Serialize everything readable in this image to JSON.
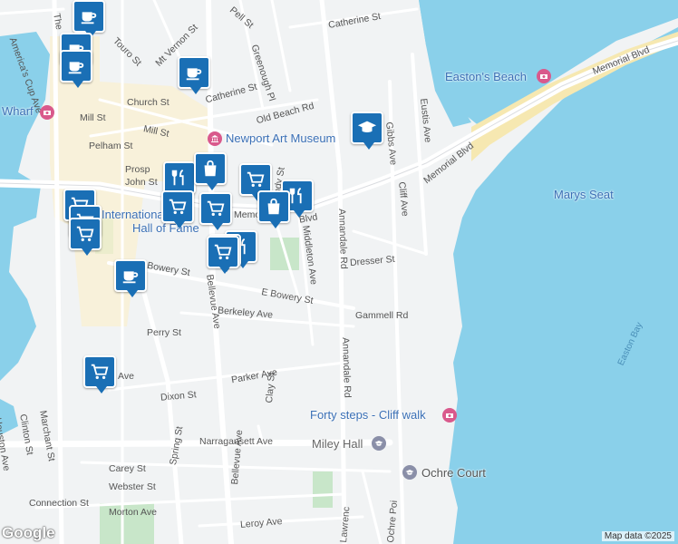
{
  "streets": {
    "americas_cup_ave": "America's Cup Ave",
    "touro_st": "Touro St",
    "mt_vernon_st": "Mt Vernon St",
    "pell_st": "Pell St",
    "catherine_st_ne": "Catherine St",
    "catherine_st": "Catherine St",
    "greenough_pl": "Greenough Pl",
    "church_st": "Church St",
    "old_beach_rd": "Old Beach Rd",
    "mill_st": "Mill St",
    "mill_st_2": "Mill St",
    "pelham_st": "Pelham St",
    "prospect": "Prosp",
    "john_st": "John St",
    "memorial_blvd_ne": "Memorial Blvd",
    "memorial_blvd_mid": "Memorial Blvd",
    "memorial_blvd_w": "Memo",
    "memorial_blvd_w2": "Blvd",
    "gibbs_ave": "Gibbs Ave",
    "eustis_ave": "Eustis Ave",
    "cliff_ave": "Cliff Ave",
    "annandale_rd": "Annandale Rd",
    "annandale_rd_2": "Annandale Rd",
    "middleton_ave": "Middleton Ave",
    "freebody_st": "Freebody St",
    "dresser_st": "Dresser St",
    "bowery_st": "Bowery St",
    "e_bowery_st": "E Bowery St",
    "bellevue_ave_top": "Bellevue Ave",
    "bellevue_ave": "Bellevue Ave",
    "gammell_rd": "Gammell Rd",
    "berkeley_ave": "Berkeley Ave",
    "perry_st": "Perry St",
    "parker_ave": "Parker Ave",
    "dixon_st": "Dixon St",
    "ave_w": "Ave",
    "clay_st": "Clay St",
    "narragansett_ave": "Narragansett Ave",
    "houston_ave": "Houston Ave",
    "clinton_st": "Clinton St",
    "marchant_st": "Marchant St",
    "spring_st": "Spring St",
    "carey_st": "Carey St",
    "webster_st": "Webster St",
    "connection_st": "Connection St",
    "morton_ave": "Morton Ave",
    "leroy_ave": "Leroy Ave",
    "lawrence": "Lawrenc",
    "ochre_point": "Ochre Poi",
    "the_left": "The"
  },
  "places": {
    "eastons_beach": "Easton's Beach",
    "newport_art_museum": "Newport Art Museum",
    "marys_seat": "Marys Seat",
    "international_hall": "International",
    "hall_of_fame": "Hall of Fame",
    "forty_steps": "Forty steps - Cliff walk",
    "miley_hall": "Miley Hall",
    "ochre_court": "Ochre Court",
    "wharf": "Wharf"
  },
  "water": {
    "easton_bay": "Easton Bay"
  },
  "attribution": "Map data ©2025",
  "logo": "Google",
  "colors": {
    "water": "#8ad0ea",
    "land": "#f1f3f4",
    "park": "#c8e6c9",
    "beach": "#f6e8b1",
    "commercial": "#fbf0cf",
    "pin": "#1a6fb5",
    "poi_label": "#3a6fb5",
    "attraction": "#d9598c"
  },
  "markers": [
    {
      "icon": "coffee-icon",
      "kind": "cafe"
    },
    {
      "icon": "coffee-icon",
      "kind": "cafe"
    },
    {
      "icon": "coffee-icon",
      "kind": "cafe"
    },
    {
      "icon": "coffee-icon",
      "kind": "cafe"
    },
    {
      "icon": "graduation-cap-icon",
      "kind": "school"
    },
    {
      "icon": "restaurant-icon",
      "kind": "restaurant"
    },
    {
      "icon": "shopping-bag-icon",
      "kind": "store"
    },
    {
      "icon": "shopping-cart-icon",
      "kind": "grocery"
    },
    {
      "icon": "restaurant-icon",
      "kind": "restaurant"
    },
    {
      "icon": "shopping-cart-icon",
      "kind": "grocery"
    },
    {
      "icon": "shopping-cart-icon",
      "kind": "grocery"
    },
    {
      "icon": "shopping-bag-icon",
      "kind": "store"
    },
    {
      "icon": "restaurant-icon",
      "kind": "restaurant"
    },
    {
      "icon": "shopping-cart-icon",
      "kind": "grocery"
    },
    {
      "icon": "restaurant-icon",
      "kind": "restaurant"
    },
    {
      "icon": "shopping-cart-icon",
      "kind": "grocery"
    },
    {
      "icon": "shopping-cart-icon",
      "kind": "grocery"
    },
    {
      "icon": "coffee-icon",
      "kind": "cafe"
    },
    {
      "icon": "shopping-cart-icon",
      "kind": "grocery"
    },
    {
      "icon": "shopping-cart-icon",
      "kind": "grocery"
    }
  ]
}
